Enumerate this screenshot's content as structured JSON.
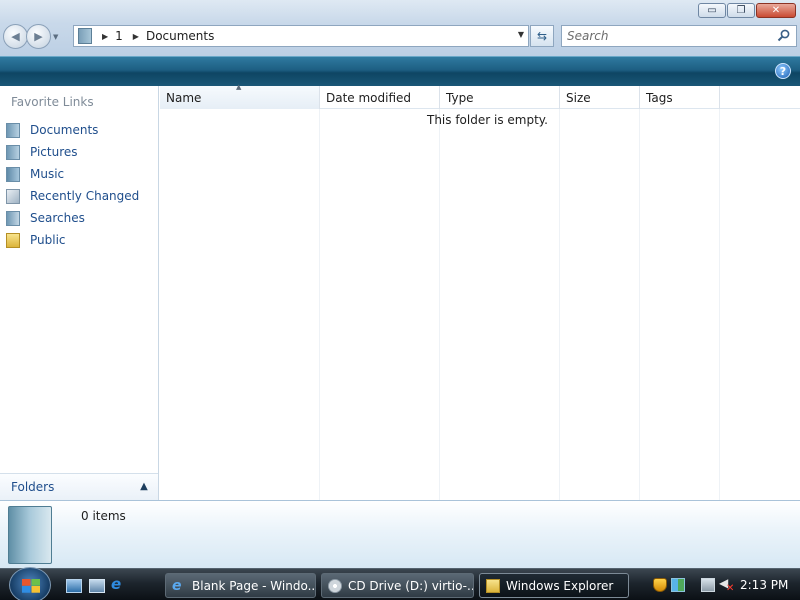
{
  "window": {
    "controls": {
      "minimize": "▭",
      "maximize": "❐",
      "close": "✕"
    }
  },
  "nav": {
    "back_icon": "back-arrow-icon",
    "forward_icon": "forward-arrow-icon"
  },
  "address": {
    "crumbs": [
      "1",
      "Documents"
    ]
  },
  "search": {
    "placeholder": "Search"
  },
  "command_bar": {
    "help": "?"
  },
  "favorites": {
    "title": "Favorite Links",
    "items": [
      {
        "label": "Documents",
        "icon": "documents-icon"
      },
      {
        "label": "Pictures",
        "icon": "pictures-icon"
      },
      {
        "label": "Music",
        "icon": "music-icon"
      },
      {
        "label": "Recently Changed",
        "icon": "recently-changed-icon"
      },
      {
        "label": "Searches",
        "icon": "searches-icon"
      },
      {
        "label": "Public",
        "icon": "public-folder-icon"
      }
    ]
  },
  "folders": {
    "label": "Folders"
  },
  "file_list": {
    "columns": [
      "Name",
      "Date modified",
      "Type",
      "Size",
      "Tags"
    ],
    "sorted_column": "Name",
    "empty_message": "This folder is empty."
  },
  "details": {
    "count": "0 items"
  },
  "taskbar": {
    "tasks": [
      {
        "label": "Blank Page - Windo...",
        "icon": "ie-icon"
      },
      {
        "label": "CD Drive (D:) virtio-...",
        "icon": "cd-drive-icon"
      },
      {
        "label": "Windows Explorer",
        "icon": "folder-icon",
        "active": true
      }
    ],
    "clock": "2:13 PM"
  },
  "colors": {
    "command_bar": "#1d5e82",
    "link": "#1f4e8c",
    "taskbar": "#1d252d"
  }
}
